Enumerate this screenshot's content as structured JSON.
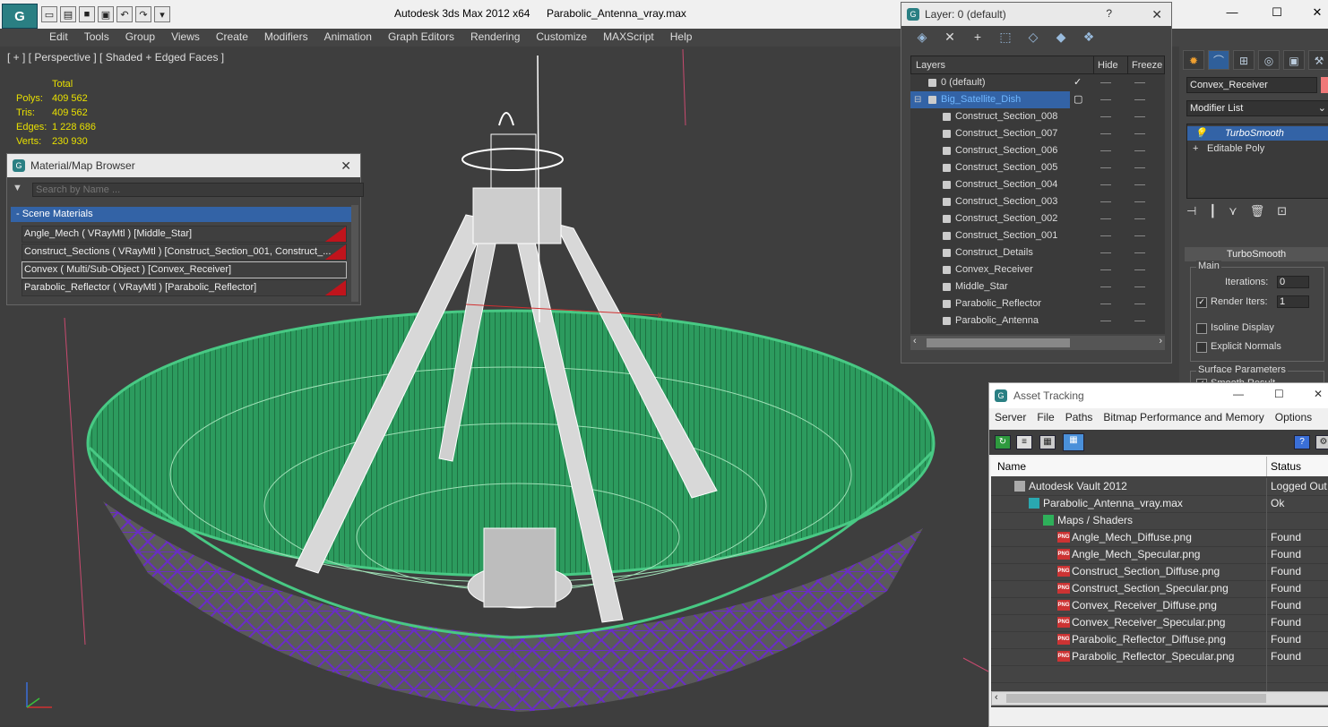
{
  "window": {
    "app_title": "Autodesk 3ds Max  2012 x64",
    "file_title": "Parabolic_Antenna_vray.max",
    "logo_glyph": "G"
  },
  "menu": [
    "Edit",
    "Tools",
    "Group",
    "Views",
    "Create",
    "Modifiers",
    "Animation",
    "Graph Editors",
    "Rendering",
    "Customize",
    "MAXScript",
    "Help"
  ],
  "viewport": {
    "label": "[ + ] [ Perspective ] [ Shaded + Edged Faces ]",
    "stats": {
      "header": "Total",
      "rows": [
        {
          "label": "Polys:",
          "value": "409 562"
        },
        {
          "label": "Tris:",
          "value": "409 562"
        },
        {
          "label": "Edges:",
          "value": "1 228 686"
        },
        {
          "label": "Verts:",
          "value": "230 930"
        }
      ]
    },
    "colors": {
      "dish_green": "#2fa866",
      "truss_purple": "#6a2cc6",
      "wire_white": "#f2f2f2"
    }
  },
  "material_browser": {
    "title": "Material/Map Browser",
    "search_placeholder": "Search by Name ...",
    "category": "- Scene Materials",
    "items": [
      "Angle_Mech  ( VRayMtl )  [Middle_Star]",
      "Construct_Sections  ( VRayMtl )  [Construct_Section_001, Construct_...",
      "Convex  ( Multi/Sub-Object )  [Convex_Receiver]",
      "Parabolic_Reflector  ( VRayMtl )  [Parabolic_Reflector]"
    ]
  },
  "layer_panel": {
    "title": "Layer: 0 (default)",
    "help": "?",
    "columns": [
      "Layers",
      "Hide",
      "Freeze"
    ],
    "rows": [
      {
        "name": "0 (default)",
        "indent": 0,
        "active": true
      },
      {
        "name": "Big_Satellite_Dish",
        "indent": 0,
        "selected": true
      },
      {
        "name": "Construct_Section_008",
        "indent": 1
      },
      {
        "name": "Construct_Section_007",
        "indent": 1
      },
      {
        "name": "Construct_Section_006",
        "indent": 1
      },
      {
        "name": "Construct_Section_005",
        "indent": 1
      },
      {
        "name": "Construct_Section_004",
        "indent": 1
      },
      {
        "name": "Construct_Section_003",
        "indent": 1
      },
      {
        "name": "Construct_Section_002",
        "indent": 1
      },
      {
        "name": "Construct_Section_001",
        "indent": 1
      },
      {
        "name": "Construct_Details",
        "indent": 1
      },
      {
        "name": "Convex_Receiver",
        "indent": 1
      },
      {
        "name": "Middle_Star",
        "indent": 1
      },
      {
        "name": "Parabolic_Reflector",
        "indent": 1
      },
      {
        "name": "Parabolic_Antenna",
        "indent": 1
      }
    ]
  },
  "command_panel": {
    "object_name": "Convex_Receiver",
    "modifier_list": "Modifier List",
    "stack": [
      "TurboSmooth",
      "Editable Poly"
    ],
    "rollout": "TurboSmooth",
    "main_group": "Main",
    "iterations_label": "Iterations:",
    "iterations_value": "0",
    "render_iters_label": "Render Iters:",
    "render_iters_value": "1",
    "isoline_label": "Isoline Display",
    "explicit_label": "Explicit Normals",
    "surface_group": "Surface Parameters",
    "smooth_result": "Smooth Result"
  },
  "asset_tracking": {
    "title": "Asset Tracking",
    "menu": [
      "Server",
      "File",
      "Paths",
      "Bitmap Performance and Memory",
      "Options"
    ],
    "columns": [
      "Name",
      "Status"
    ],
    "rows": [
      {
        "name": "Autodesk Vault 2012",
        "status": "Logged Out",
        "indent": 1,
        "icon": "vault"
      },
      {
        "name": "Parabolic_Antenna_vray.max",
        "status": "Ok",
        "indent": 2,
        "icon": "max"
      },
      {
        "name": "Maps / Shaders",
        "status": "",
        "indent": 3,
        "icon": "maps"
      },
      {
        "name": "Angle_Mech_Diffuse.png",
        "status": "Found",
        "indent": 4,
        "icon": "png"
      },
      {
        "name": "Angle_Mech_Specular.png",
        "status": "Found",
        "indent": 4,
        "icon": "png"
      },
      {
        "name": "Construct_Section_Diffuse.png",
        "status": "Found",
        "indent": 4,
        "icon": "png"
      },
      {
        "name": "Construct_Section_Specular.png",
        "status": "Found",
        "indent": 4,
        "icon": "png"
      },
      {
        "name": "Convex_Receiver_Diffuse.png",
        "status": "Found",
        "indent": 4,
        "icon": "png"
      },
      {
        "name": "Convex_Receiver_Specular.png",
        "status": "Found",
        "indent": 4,
        "icon": "png"
      },
      {
        "name": "Parabolic_Reflector_Diffuse.png",
        "status": "Found",
        "indent": 4,
        "icon": "png"
      },
      {
        "name": "Parabolic_Reflector_Specular.png",
        "status": "Found",
        "indent": 4,
        "icon": "png"
      }
    ]
  }
}
